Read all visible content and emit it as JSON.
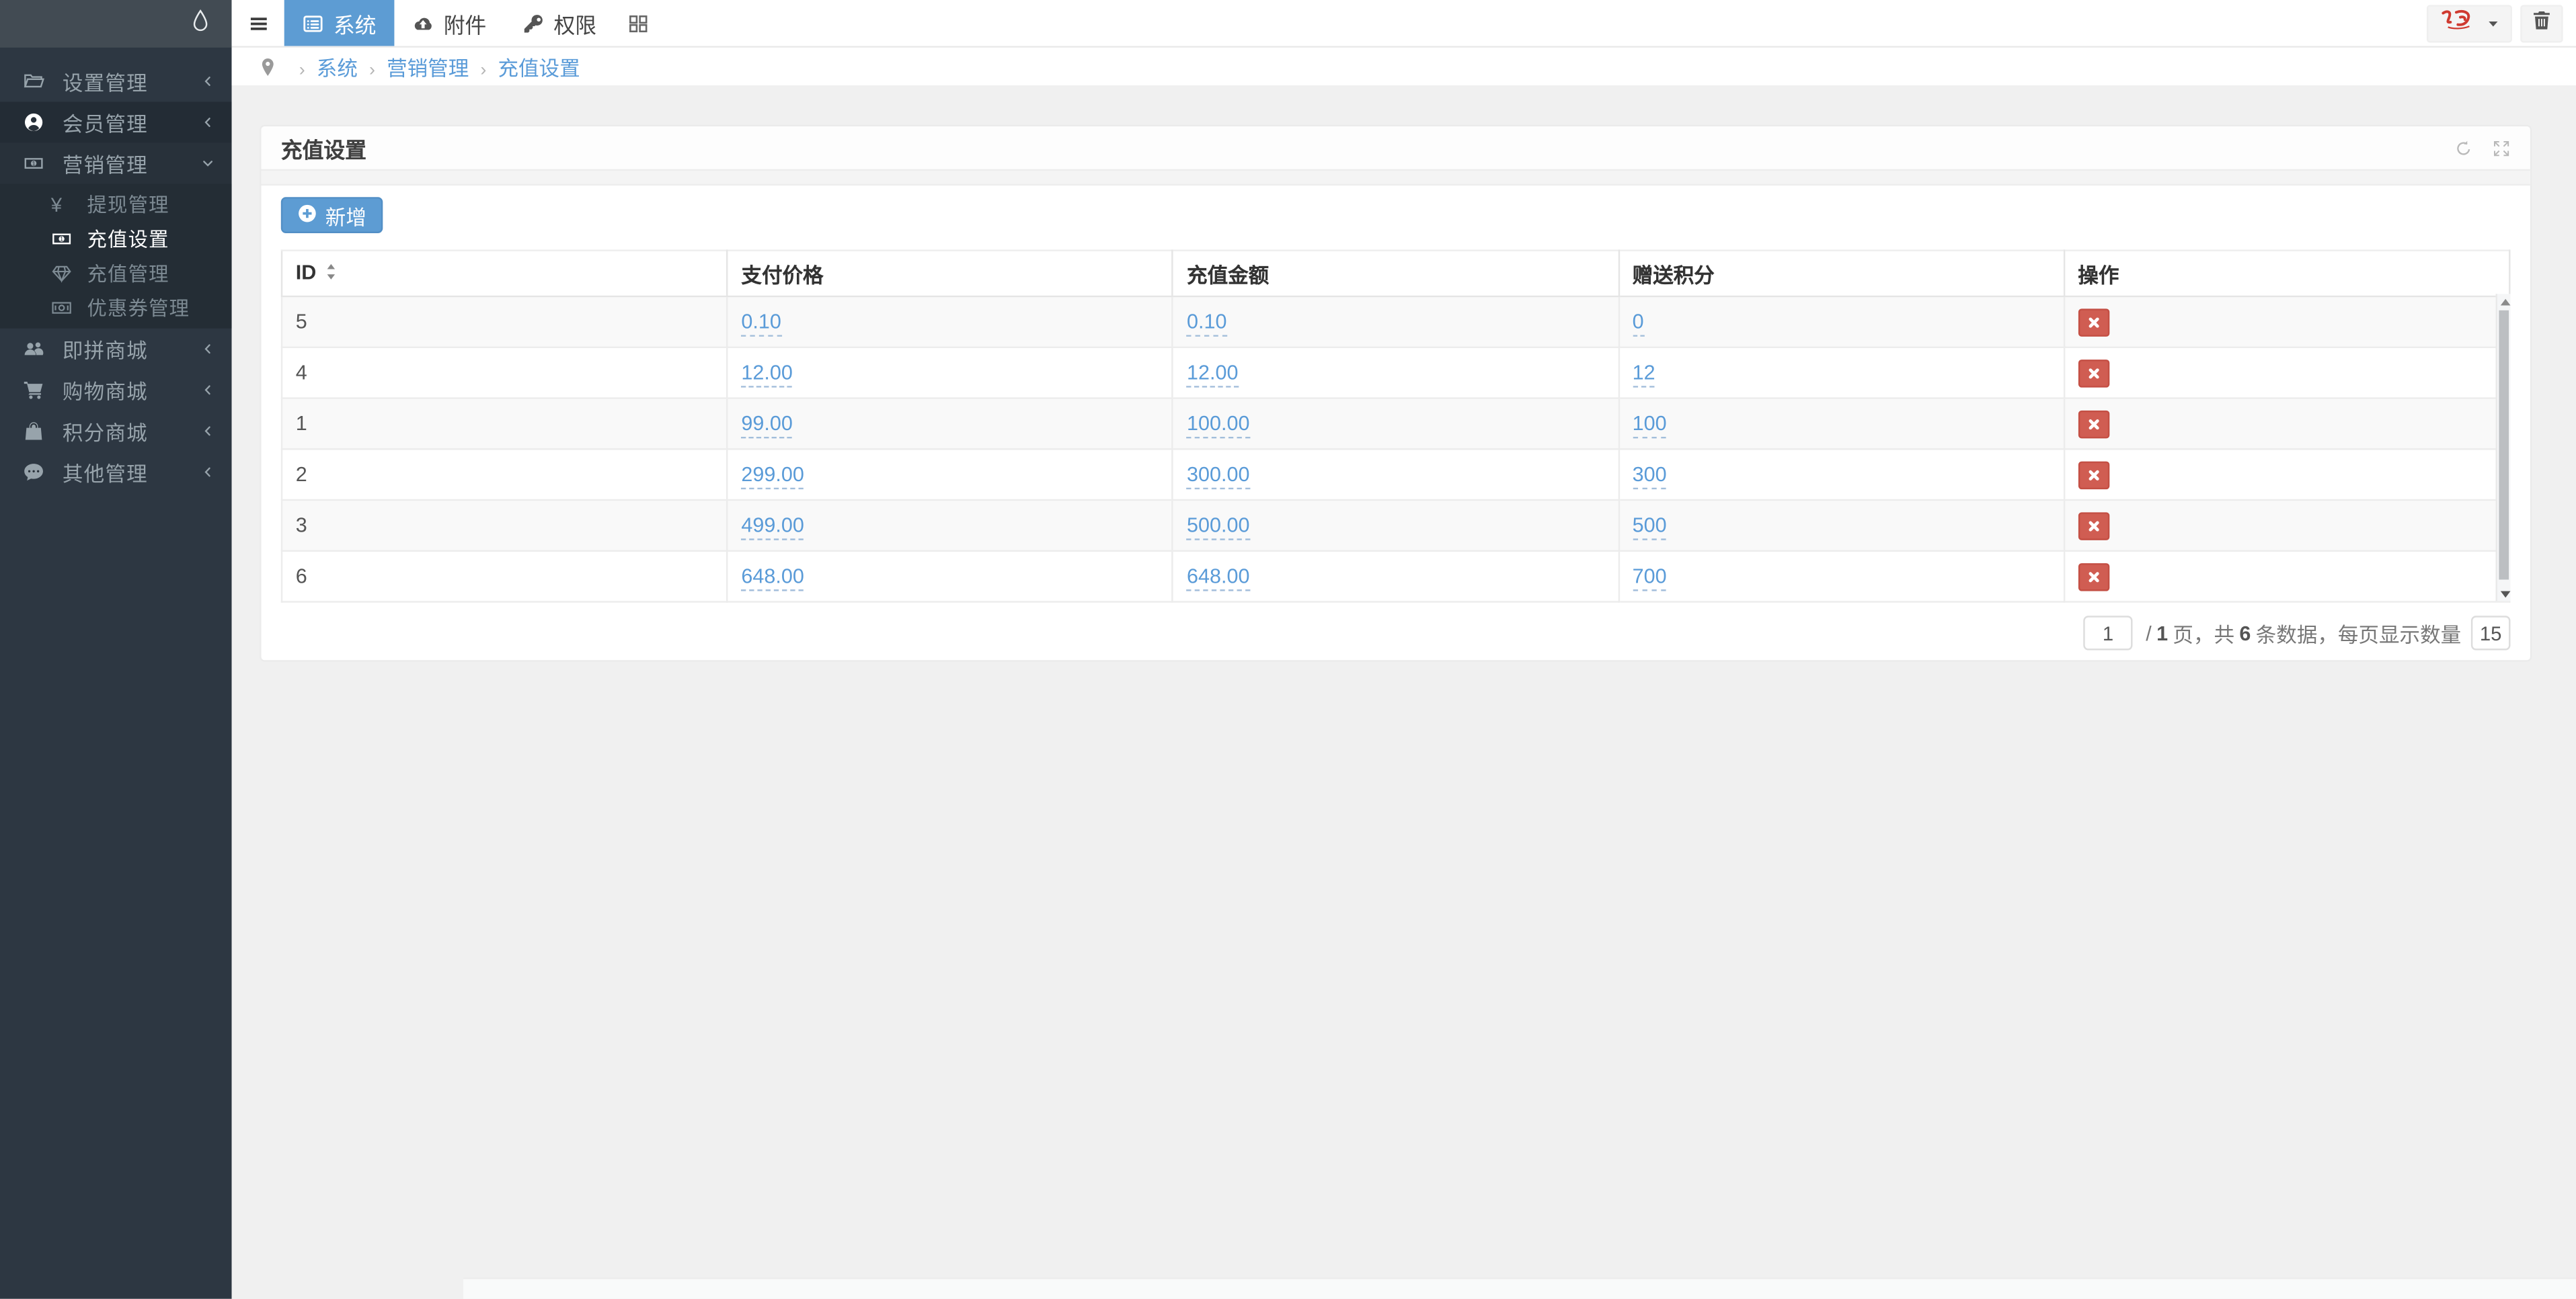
{
  "colors": {
    "accent_blue": "#5d9cd3",
    "link_blue": "#5a9bd8",
    "danger_red": "#d05d52",
    "sidebar_bg": "#2d3742",
    "page_bg": "#f0f0f0"
  },
  "sidebar": {
    "logo_icon": "droplet-icon",
    "items": [
      {
        "key": "settings",
        "label": "设置管理",
        "icon": "folder-icon",
        "chevron": "left",
        "state": "normal"
      },
      {
        "key": "members",
        "label": "会员管理",
        "icon": "user-icon",
        "chevron": "left",
        "state": "dark"
      },
      {
        "key": "marketing",
        "label": "营销管理",
        "icon": "money-icon",
        "chevron": "down",
        "state": "open",
        "children": [
          {
            "key": "withdraw-manage",
            "label": "提现管理",
            "icon": "yen-icon",
            "active": false
          },
          {
            "key": "recharge-config",
            "label": "充值设置",
            "icon": "money-icon",
            "active": true
          },
          {
            "key": "recharge-manage",
            "label": "充值管理",
            "icon": "diamond-icon",
            "active": false
          },
          {
            "key": "coupon-manage",
            "label": "优惠券管理",
            "icon": "coupon-icon",
            "active": false
          }
        ]
      },
      {
        "key": "group-mall",
        "label": "即拼商城",
        "icon": "users-icon",
        "chevron": "left",
        "state": "normal"
      },
      {
        "key": "shop-mall",
        "label": "购物商城",
        "icon": "cart-icon",
        "chevron": "left",
        "state": "normal"
      },
      {
        "key": "points-mall",
        "label": "积分商城",
        "icon": "bag-icon",
        "chevron": "left",
        "state": "normal"
      },
      {
        "key": "other-manage",
        "label": "其他管理",
        "icon": "comment-icon",
        "chevron": "left",
        "state": "normal"
      }
    ]
  },
  "navbar": {
    "menu_toggle_icon": "bars-icon",
    "tabs": [
      {
        "key": "system",
        "label": "系统",
        "icon": "list-alt-icon",
        "active": true
      },
      {
        "key": "attachment",
        "label": "附件",
        "icon": "cloud-upload-icon",
        "active": false
      },
      {
        "key": "auth",
        "label": "权限",
        "icon": "key-icon",
        "active": false
      }
    ],
    "grid_icon": "th-large-icon",
    "user_menu": {
      "logo_icon": "brand-logo",
      "caret_icon": "caret-down-icon"
    },
    "trash_icon": "trash-icon"
  },
  "breadcrumb": {
    "pin_icon": "map-pin-icon",
    "items": [
      {
        "key": "system",
        "label": "系统"
      },
      {
        "key": "marketing",
        "label": "营销管理"
      },
      {
        "key": "recharge",
        "label": "充值设置"
      }
    ]
  },
  "panel": {
    "title": "充值设置",
    "tools": [
      {
        "key": "refresh",
        "icon": "refresh-icon"
      },
      {
        "key": "fullscreen",
        "icon": "expand-icon"
      }
    ]
  },
  "toolbar": {
    "add_label": "新增",
    "add_icon": "plus-circle-icon"
  },
  "table": {
    "columns": [
      {
        "key": "id",
        "label": "ID",
        "sortable": true,
        "sort_icon": "sort-icon"
      },
      {
        "key": "price",
        "label": "支付价格"
      },
      {
        "key": "amount",
        "label": "充值金额"
      },
      {
        "key": "points",
        "label": "赠送积分"
      },
      {
        "key": "op",
        "label": "操作"
      }
    ],
    "delete_icon": "x-icon",
    "rows": [
      {
        "id": "5",
        "price": "0.10",
        "amount": "0.10",
        "points": "0"
      },
      {
        "id": "4",
        "price": "12.00",
        "amount": "12.00",
        "points": "12"
      },
      {
        "id": "1",
        "price": "99.00",
        "amount": "100.00",
        "points": "100"
      },
      {
        "id": "2",
        "price": "299.00",
        "amount": "300.00",
        "points": "300"
      },
      {
        "id": "3",
        "price": "499.00",
        "amount": "500.00",
        "points": "500"
      },
      {
        "id": "6",
        "price": "648.00",
        "amount": "648.00",
        "points": "700"
      }
    ]
  },
  "pagination": {
    "current_page": "1",
    "slash": "/",
    "total_pages": "1",
    "pages_label": "页，共",
    "total_records": "6",
    "records_label": "条数据，每页显示数量",
    "page_size": "15"
  }
}
